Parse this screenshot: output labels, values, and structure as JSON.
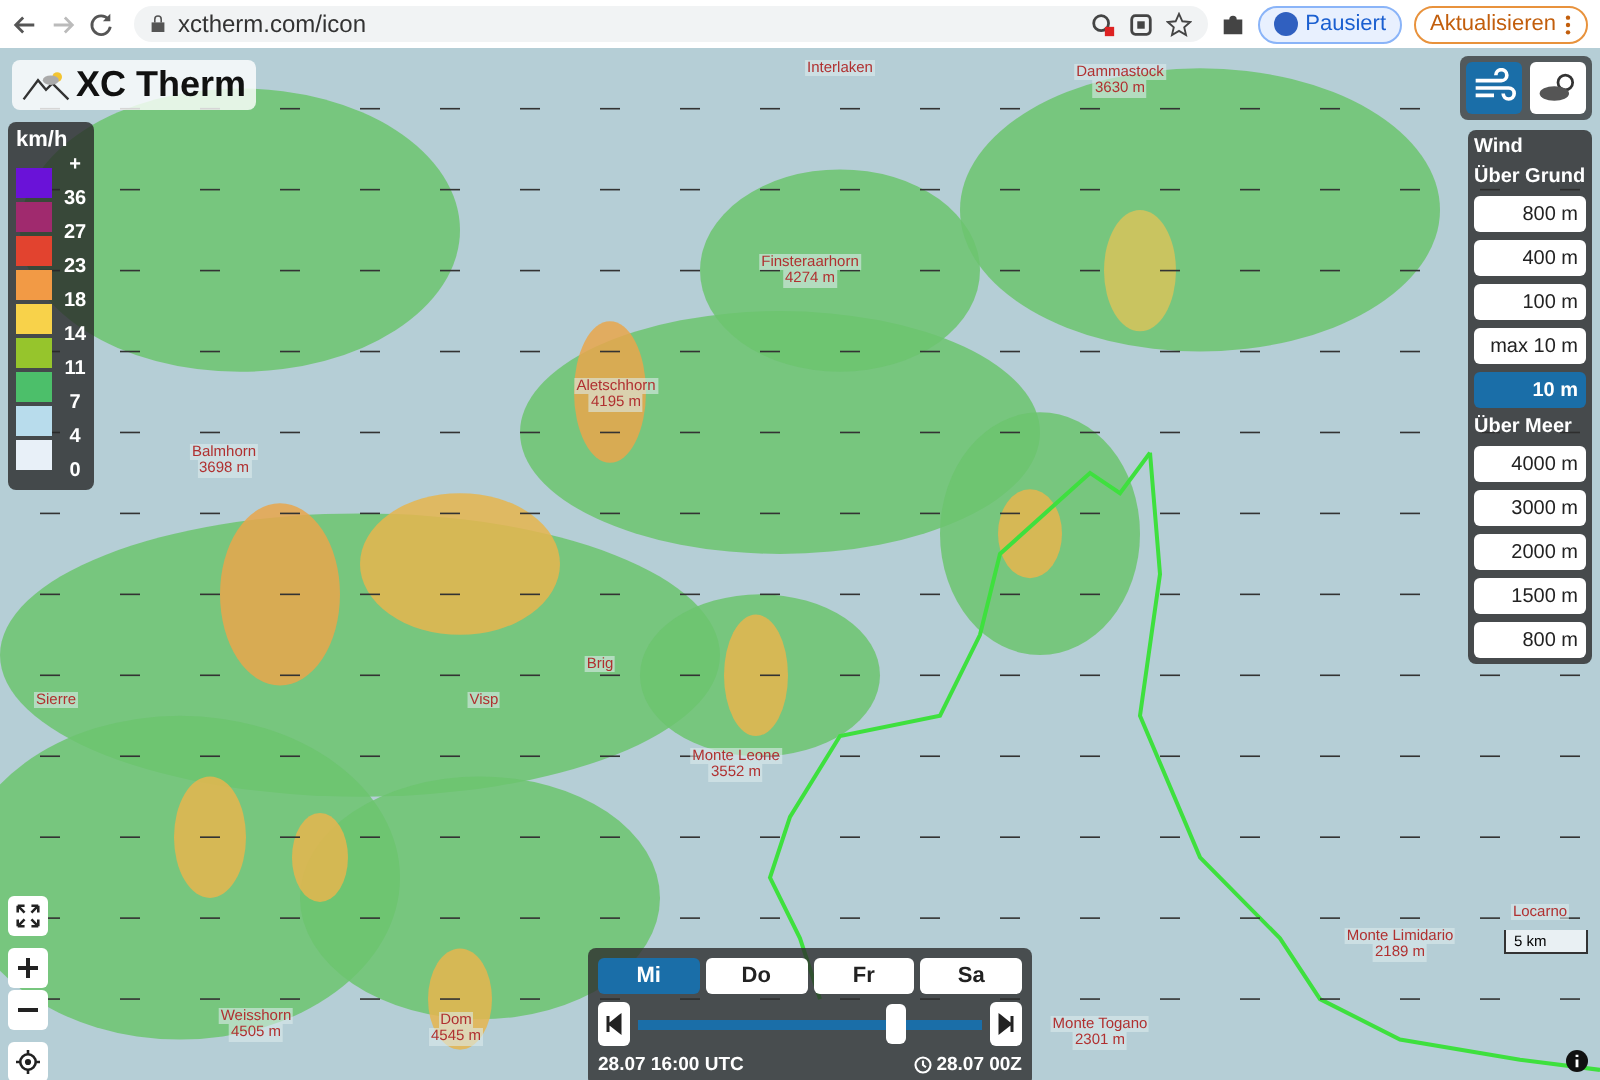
{
  "browser": {
    "url": "xctherm.com/icon",
    "profile": "Pausiert",
    "update": "Aktualisieren"
  },
  "logo": "XC Therm",
  "legend": {
    "unit": "km/h",
    "labels": [
      "+",
      "36",
      "27",
      "23",
      "18",
      "14",
      "11",
      "7",
      "4",
      "0"
    ],
    "bins": [
      {
        "color": "#6a12d8"
      },
      {
        "color": "#a02a6e"
      },
      {
        "color": "#e2432f"
      },
      {
        "color": "#f29a45"
      },
      {
        "color": "#f8d24a"
      },
      {
        "color": "#96c52c"
      },
      {
        "color": "#4cbf6a"
      },
      {
        "color": "#b8dcec"
      },
      {
        "color": "#e8f0f8"
      }
    ]
  },
  "layers": [
    {
      "kind": "wind",
      "selected": true
    },
    {
      "kind": "clouds",
      "selected": false
    }
  ],
  "wind_panel": {
    "title": "Wind",
    "groups": [
      {
        "title": "Über Grund",
        "items": [
          {
            "label": "800 m",
            "selected": false
          },
          {
            "label": "400 m",
            "selected": false
          },
          {
            "label": "100 m",
            "selected": false
          },
          {
            "label": "max 10 m",
            "selected": false
          },
          {
            "label": "10 m",
            "selected": true
          }
        ]
      },
      {
        "title": "Über Meer",
        "items": [
          {
            "label": "4000 m",
            "selected": false
          },
          {
            "label": "3000 m",
            "selected": false
          },
          {
            "label": "2000 m",
            "selected": false
          },
          {
            "label": "1500 m",
            "selected": false
          },
          {
            "label": "800 m",
            "selected": false
          }
        ]
      }
    ]
  },
  "places": [
    {
      "name": "Interlaken"
    },
    {
      "name": "Dammastock",
      "height": "3630 m"
    },
    {
      "name": "Finsteraarhorn",
      "height": "4274 m"
    },
    {
      "name": "Aletschhorn",
      "height": "4195 m"
    },
    {
      "name": "Balmhorn",
      "height": "3698 m"
    },
    {
      "name": "Sierre"
    },
    {
      "name": "Visp"
    },
    {
      "name": "Brig"
    },
    {
      "name": "Monte Leone",
      "height": "3552 m"
    },
    {
      "name": "Weisshorn",
      "height": "4505 m"
    },
    {
      "name": "Dom",
      "height": "4545 m"
    },
    {
      "name": "Monte Togano",
      "height": "2301 m"
    },
    {
      "name": "Monte Limidario",
      "height": "2189 m"
    },
    {
      "name": "Locarno"
    }
  ],
  "scale": "5 km",
  "timeline": {
    "days": [
      {
        "label": "Mi",
        "selected": true
      },
      {
        "label": "Do",
        "selected": false
      },
      {
        "label": "Fr",
        "selected": false
      },
      {
        "label": "Sa",
        "selected": false
      }
    ],
    "level": 0.75,
    "current": "28.07 16:00 UTC",
    "run": "28.07 00Z"
  }
}
